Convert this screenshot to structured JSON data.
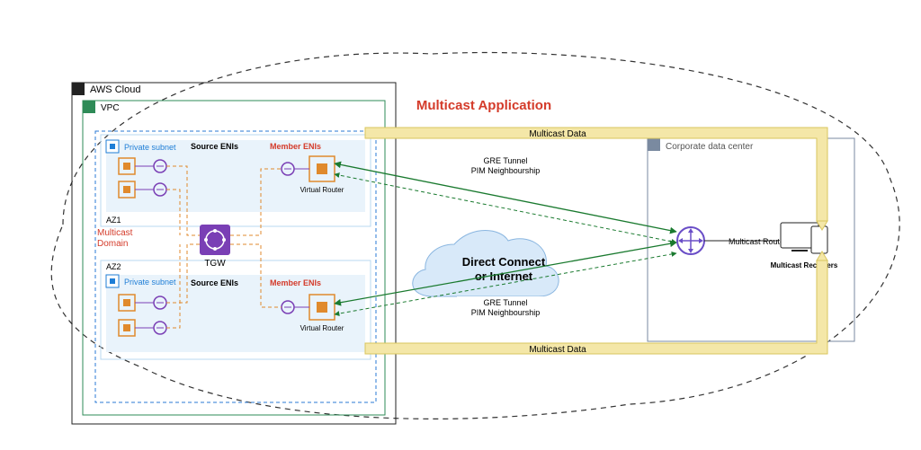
{
  "title": "Multicast Application",
  "aws_cloud": "AWS Cloud",
  "vpc": "VPC",
  "az1": "AZ1",
  "az2": "AZ2",
  "subnet1": "Private subnet",
  "subnet2": "Private subnet",
  "source_enis1": "Source ENIs",
  "source_enis2": "Source ENIs",
  "member_enis1": "Member ENIs",
  "member_enis2": "Member ENIs",
  "vrouter1": "Virtual Router",
  "vrouter2": "Virtual Router",
  "tgw": "TGW",
  "mcast_domain": "Multicast\nDomain",
  "cloud_text1": "Direct Connect",
  "cloud_text2": "or Internet",
  "gre1": "GRE Tunnel",
  "pim1": "PIM Neighbourship",
  "gre2": "GRE Tunnel",
  "pim2": "PIM Neighbourship",
  "mdata_top": "Multicast Data",
  "mdata_bot": "Multicast Data",
  "corp_dc": "Corporate data center",
  "mrouter": "Multicast Router",
  "mreceivers": "Multicast Receivers"
}
